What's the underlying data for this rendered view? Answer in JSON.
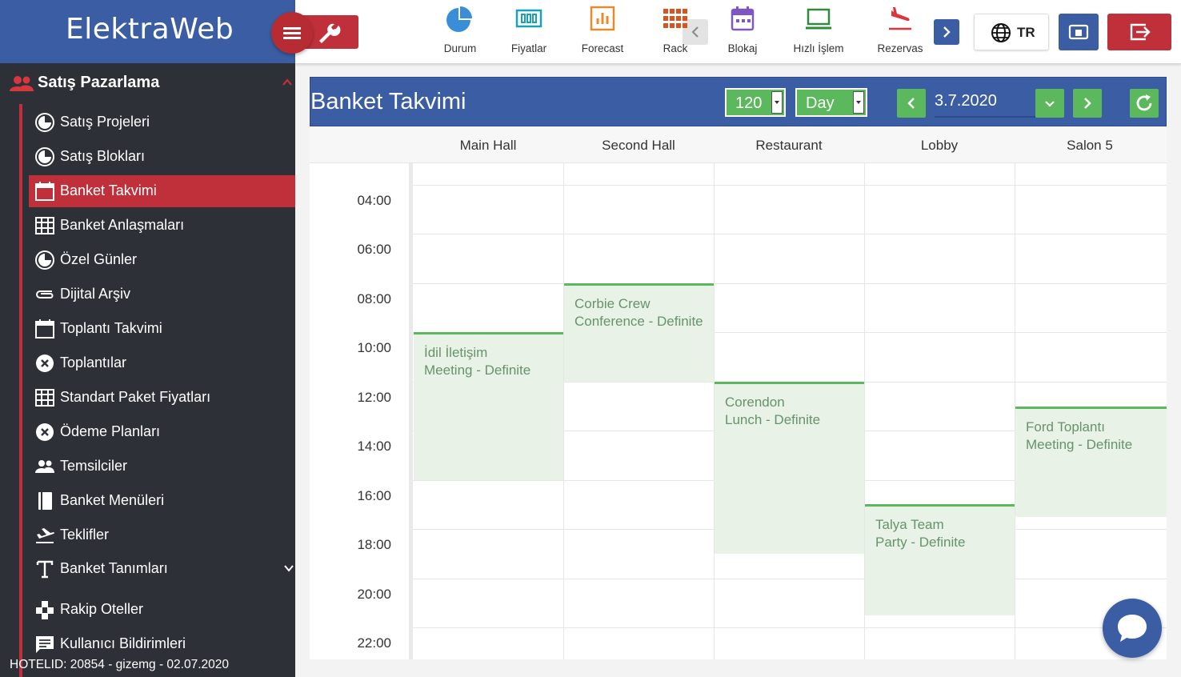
{
  "app": {
    "brand": "ElektraWeb"
  },
  "sidebar": {
    "section_title": "Satış Pazarlama",
    "items": [
      {
        "label": "Satış Projeleri",
        "icon": "pie-chart-icon"
      },
      {
        "label": "Satış Blokları",
        "icon": "pie-chart-icon"
      },
      {
        "label": "Banket Takvimi",
        "icon": "calendar-icon",
        "active": true
      },
      {
        "label": "Banket Anlaşmaları",
        "icon": "grid-icon"
      },
      {
        "label": "Özel Günler",
        "icon": "pie-chart-icon"
      },
      {
        "label": "Dijital Arşiv",
        "icon": "paperclip-icon"
      },
      {
        "label": "Toplantı Takvimi",
        "icon": "calendar-icon"
      },
      {
        "label": "Toplantılar",
        "icon": "x-circle-icon"
      },
      {
        "label": "Standart Paket Fiyatları",
        "icon": "grid-icon"
      },
      {
        "label": "Ödeme Planları",
        "icon": "x-circle-icon"
      },
      {
        "label": "Temsilciler",
        "icon": "people-icon"
      },
      {
        "label": "Banket Menüleri",
        "icon": "book-icon"
      },
      {
        "label": "Teklifler",
        "icon": "plane-icon"
      },
      {
        "label": "Banket Tanımları",
        "icon": "text-t-icon"
      },
      {
        "label": "Rakip Oteller",
        "icon": "puzzle-icon"
      },
      {
        "label": "Kullanıcı Bildirimleri",
        "icon": "chat-icon"
      }
    ],
    "footer": "HOTELID: 20854 - gizemg - 02.07.2020"
  },
  "toolbar": {
    "tools": [
      {
        "label": "Durum",
        "icon": "pie-chart-icon",
        "color": "#3a8ed8"
      },
      {
        "label": "Fiyatlar",
        "icon": "price-tag-icon",
        "color": "#17a2b8"
      },
      {
        "label": "Forecast",
        "icon": "bar-chart-icon",
        "color": "#e8892b"
      },
      {
        "label": "Rack",
        "icon": "grid-icon",
        "color": "#d9531e"
      },
      {
        "label": "Blokaj",
        "icon": "calendar-icon",
        "color": "#7e57c2"
      },
      {
        "label": "Hızlı İşlem",
        "icon": "laptop-icon",
        "color": "#2e8b3c"
      },
      {
        "label": "Rezervas",
        "icon": "plane-landing-icon",
        "color": "#d9363e"
      }
    ],
    "language": "TR"
  },
  "calendar": {
    "title": "Banket Takvimi",
    "interval": "120",
    "view": "Day",
    "date": "3.7.2020",
    "rooms": [
      "Main Hall",
      "Second Hall",
      "Restaurant",
      "Lobby",
      "Salon 5"
    ],
    "times": [
      "04:00",
      "06:00",
      "08:00",
      "10:00",
      "12:00",
      "14:00",
      "16:00",
      "18:00",
      "20:00",
      "22:00"
    ],
    "events": [
      {
        "room": 1,
        "line1": "Corbie Crew",
        "line2": "Conference - Definite",
        "start": "08:00",
        "end": "12:00"
      },
      {
        "room": 0,
        "line1": "İdil İletişim",
        "line2": "Meeting - Definite",
        "start": "10:00",
        "end": "16:00"
      },
      {
        "room": 2,
        "line1": "Corendon",
        "line2": "Lunch - Definite",
        "start": "12:00",
        "end": "19:00"
      },
      {
        "room": 4,
        "line1": "Ford Toplantı",
        "line2": "Meeting - Definite",
        "start": "13:00",
        "end": "17:30"
      },
      {
        "room": 3,
        "line1": "Talya Team",
        "line2": "Party - Definite",
        "start": "17:00",
        "end": "21:30"
      }
    ]
  }
}
